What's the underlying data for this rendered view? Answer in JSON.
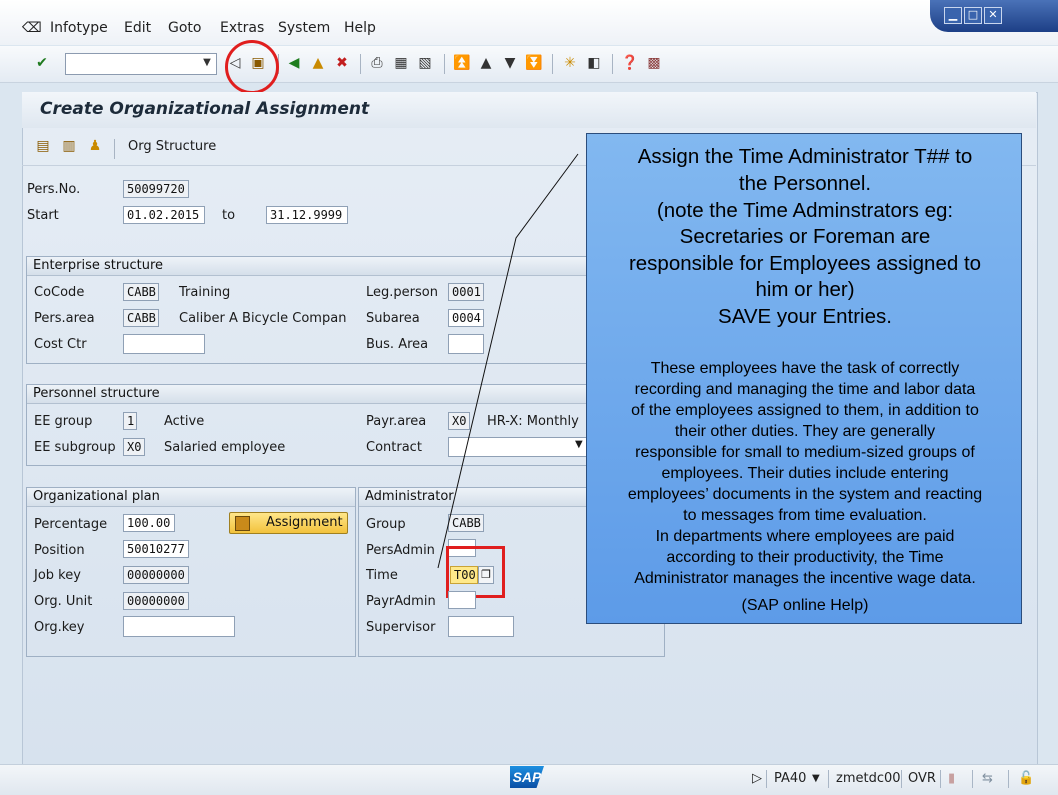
{
  "menu": {
    "items": [
      "Infotype",
      "Edit",
      "Goto",
      "Extras",
      "System",
      "Help"
    ],
    "window_controls": [
      "minimize",
      "maximize",
      "close"
    ]
  },
  "toolbar": {
    "command_field_value": "",
    "icons": [
      "enter-icon",
      "back-icon",
      "save-icon",
      "back-green-icon",
      "exit-icon",
      "cancel-icon",
      "print-icon",
      "find-icon",
      "find-next-icon",
      "first-page-icon",
      "prev-page-icon",
      "next-page-icon",
      "last-page-icon",
      "new-session-icon",
      "shortcut-icon",
      "help-icon",
      "layout-icon"
    ]
  },
  "screen": {
    "title": "Create Organizational Assignment",
    "app_toolbar": {
      "org_structure_label": "Org Structure"
    }
  },
  "header": {
    "persno_label": "Pers.No.",
    "persno_value": "50099720",
    "start_label": "Start",
    "start_value": "01.02.2015",
    "to_label": "to",
    "end_value": "31.12.9999"
  },
  "enterprise": {
    "title": "Enterprise structure",
    "cocode_label": "CoCode",
    "cocode_value": "CABB",
    "cocode_text": "Training",
    "persarea_label": "Pers.area",
    "persarea_value": "CABB",
    "persarea_text": "Caliber A Bicycle Compan",
    "costctr_label": "Cost Ctr",
    "costctr_value": "",
    "legperson_label": "Leg.person",
    "legperson_value": "0001",
    "subarea_label": "Subarea",
    "subarea_value": "0004",
    "busarea_label": "Bus. Area",
    "busarea_value": ""
  },
  "personnel": {
    "title": "Personnel structure",
    "eegroup_label": "EE group",
    "eegroup_value": "1",
    "eegroup_text": "Active",
    "eesubgroup_label": "EE subgroup",
    "eesubgroup_value": "X0",
    "eesubgroup_text": "Salaried employee",
    "payrarea_label": "Payr.area",
    "payrarea_value": "X0",
    "payrarea_text": "HR-X: Monthly",
    "contract_label": "Contract",
    "contract_value": ""
  },
  "orgplan": {
    "title": "Organizational plan",
    "percentage_label": "Percentage",
    "percentage_value": "100.00",
    "position_label": "Position",
    "position_value": "50010277",
    "jobkey_label": "Job key",
    "jobkey_value": "00000000",
    "orgunit_label": "Org. Unit",
    "orgunit_value": "00000000",
    "orgkey_label": "Org.key",
    "orgkey_value": "",
    "assignment_label": "Assignment"
  },
  "administrator": {
    "title": "Administrator",
    "group_label": "Group",
    "group_value": "CABB",
    "persadmin_label": "PersAdmin",
    "persadmin_value": "",
    "time_label": "Time",
    "time_value": "T00",
    "payradmin_label": "PayrAdmin",
    "payradmin_value": "",
    "supervisor_label": "Supervisor",
    "supervisor_value": ""
  },
  "callout": {
    "big_lines": [
      "Assign the Time Administrator T## to",
      "the Personnel.",
      "(note the Time Adminstrators eg:",
      "Secretaries or Foreman are",
      "responsible for Employees assigned to",
      "him or her)",
      "SAVE your Entries."
    ],
    "small_lines": [
      "These employees have the task of correctly",
      "recording and managing the time and labor data",
      "of the employees assigned to them, in addition to",
      "their other duties. They are generally",
      "responsible for small to medium-sized groups of",
      "employees. Their duties include entering",
      "employees’ documents in the system and reacting",
      "to messages from time evaluation.",
      "In departments where employees are paid",
      "according to their productivity, the Time",
      "Administrator manages the incentive wage data."
    ],
    "source": "(SAP online Help)"
  },
  "statusbar": {
    "logo": "SAP",
    "transaction": "PA40",
    "server": "zmetdc00",
    "mode": "OVR"
  },
  "colors": {
    "highlight_red": "#e01e1e",
    "callout_blue": "#6ea8ec",
    "assign_yellow": "#f2c23c"
  }
}
